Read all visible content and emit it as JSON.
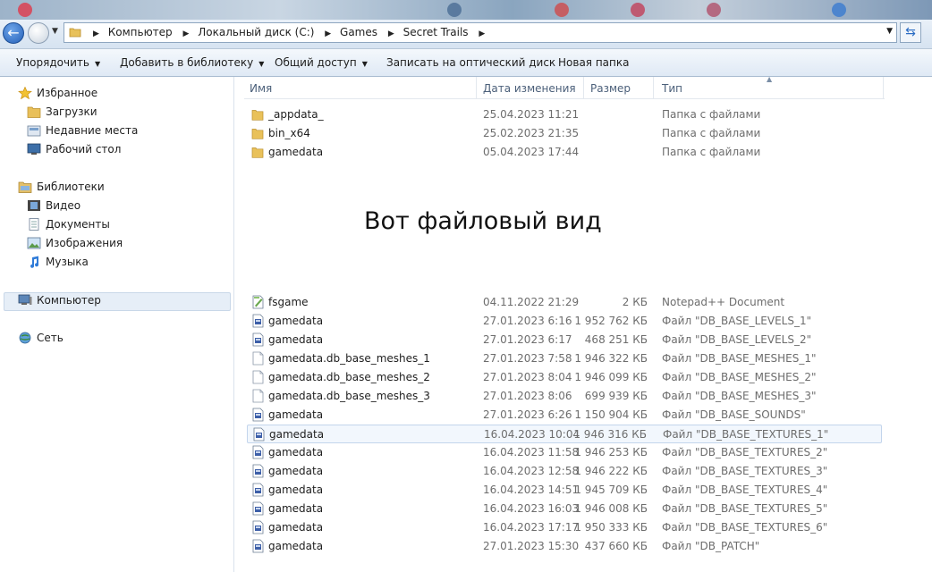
{
  "address": {
    "crumbs": [
      "Компьютер",
      "Локальный диск (C:)",
      "Games",
      "Secret Trails"
    ]
  },
  "toolbar": {
    "organize": "Упорядочить",
    "add_library": "Добавить в библиотеку",
    "share": "Общий доступ",
    "burn": "Записать на оптический диск",
    "new_folder": "Новая папка"
  },
  "nav": {
    "favorites": "Избранное",
    "downloads": "Загрузки",
    "recent": "Недавние места",
    "desktop": "Рабочий стол",
    "libraries": "Библиотеки",
    "video": "Видео",
    "documents": "Документы",
    "images": "Изображения",
    "music": "Музыка",
    "computer": "Компьютер",
    "network": "Сеть"
  },
  "columns": {
    "name": "Имя",
    "date": "Дата изменения",
    "size": "Размер",
    "type": "Тип"
  },
  "overlay_text": "Вот файловый вид",
  "folders": [
    {
      "name": "_appdata_",
      "date": "25.04.2023 11:21",
      "size": "",
      "type": "Папка с файлами"
    },
    {
      "name": "bin_x64",
      "date": "25.02.2023 21:35",
      "size": "",
      "type": "Папка с файлами"
    },
    {
      "name": "gamedata",
      "date": "05.04.2023 17:44",
      "size": "",
      "type": "Папка с файлами"
    }
  ],
  "files": [
    {
      "name": "fsgame",
      "date": "04.11.2022 21:29",
      "size": "2 КБ",
      "type": "Notepad++ Document",
      "icon": "notepad-icon"
    },
    {
      "name": "gamedata",
      "date": "27.01.2023 6:16",
      "size": "1 952 762 КБ",
      "type": "Файл \"DB_BASE_LEVELS_1\"",
      "icon": "db-file-icon"
    },
    {
      "name": "gamedata",
      "date": "27.01.2023 6:17",
      "size": "468 251 КБ",
      "type": "Файл \"DB_BASE_LEVELS_2\"",
      "icon": "db-file-icon"
    },
    {
      "name": "gamedata.db_base_meshes_1",
      "date": "27.01.2023 7:58",
      "size": "1 946 322 КБ",
      "type": "Файл \"DB_BASE_MESHES_1\"",
      "icon": "blank-file-icon"
    },
    {
      "name": "gamedata.db_base_meshes_2",
      "date": "27.01.2023 8:04",
      "size": "1 946 099 КБ",
      "type": "Файл \"DB_BASE_MESHES_2\"",
      "icon": "blank-file-icon"
    },
    {
      "name": "gamedata.db_base_meshes_3",
      "date": "27.01.2023 8:06",
      "size": "699 939 КБ",
      "type": "Файл \"DB_BASE_MESHES_3\"",
      "icon": "blank-file-icon"
    },
    {
      "name": "gamedata",
      "date": "27.01.2023 6:26",
      "size": "1 150 904 КБ",
      "type": "Файл \"DB_BASE_SOUNDS\"",
      "icon": "db-file-icon"
    },
    {
      "name": "gamedata",
      "date": "16.04.2023 10:04",
      "size": "1 946 316 КБ",
      "type": "Файл \"DB_BASE_TEXTURES_1\"",
      "icon": "db-file-icon"
    },
    {
      "name": "gamedata",
      "date": "16.04.2023 11:58",
      "size": "1 946 253 КБ",
      "type": "Файл \"DB_BASE_TEXTURES_2\"",
      "icon": "db-file-icon"
    },
    {
      "name": "gamedata",
      "date": "16.04.2023 12:58",
      "size": "1 946 222 КБ",
      "type": "Файл \"DB_BASE_TEXTURES_3\"",
      "icon": "db-file-icon"
    },
    {
      "name": "gamedata",
      "date": "16.04.2023 14:51",
      "size": "1 945 709 КБ",
      "type": "Файл \"DB_BASE_TEXTURES_4\"",
      "icon": "db-file-icon"
    },
    {
      "name": "gamedata",
      "date": "16.04.2023 16:03",
      "size": "1 946 008 КБ",
      "type": "Файл \"DB_BASE_TEXTURES_5\"",
      "icon": "db-file-icon"
    },
    {
      "name": "gamedata",
      "date": "16.04.2023 17:17",
      "size": "1 950 333 КБ",
      "type": "Файл \"DB_BASE_TEXTURES_6\"",
      "icon": "db-file-icon"
    },
    {
      "name": "gamedata",
      "date": "27.01.2023 15:30",
      "size": "437 660 КБ",
      "type": "Файл \"DB_PATCH\"",
      "icon": "db-file-icon"
    }
  ]
}
